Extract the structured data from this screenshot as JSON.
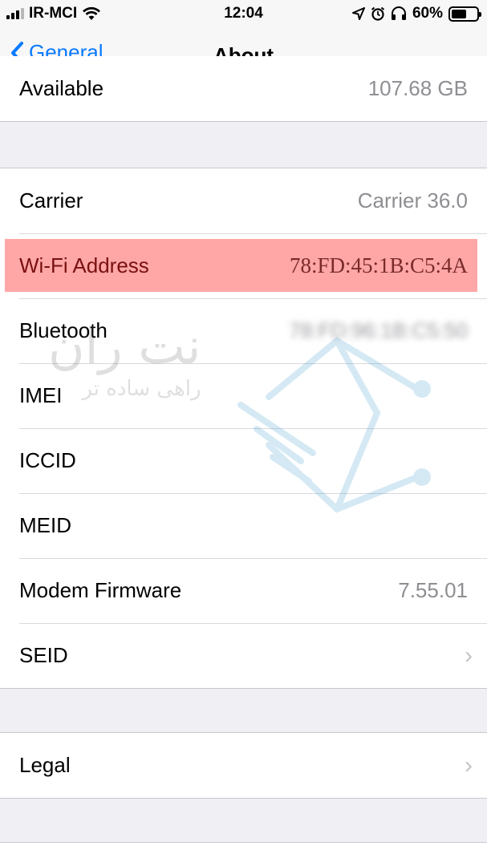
{
  "status_bar": {
    "carrier": "IR-MCI",
    "time": "12:04",
    "battery_percent": "60%",
    "battery_level": 0.6,
    "icons": [
      "signal-icon",
      "wifi-icon",
      "location-icon",
      "alarm-icon",
      "headphones-icon",
      "battery-icon"
    ]
  },
  "nav": {
    "back_label": "General",
    "title": "About"
  },
  "top_row": {
    "label": "Available",
    "value": "107.68 GB"
  },
  "rows": [
    {
      "label": "Carrier",
      "value": "Carrier 36.0"
    },
    {
      "label": "Wi-Fi Address",
      "value": "78:FD:45:1B:C5:4A"
    },
    {
      "label": "Bluetooth",
      "value": "78:FD:96:1B:C5:50"
    },
    {
      "label": "IMEI",
      "value": ""
    },
    {
      "label": "ICCID",
      "value": ""
    },
    {
      "label": "MEID",
      "value": ""
    },
    {
      "label": "Modem Firmware",
      "value": "7.55.01"
    },
    {
      "label": "SEID",
      "value": ""
    }
  ],
  "legal": {
    "label": "Legal"
  },
  "watermark": {
    "title": "نت ران",
    "subtitle": "راهی ساده تر"
  },
  "colors": {
    "accent": "#0a7aff",
    "highlight": "#ff7878",
    "background": "#efeff4"
  }
}
